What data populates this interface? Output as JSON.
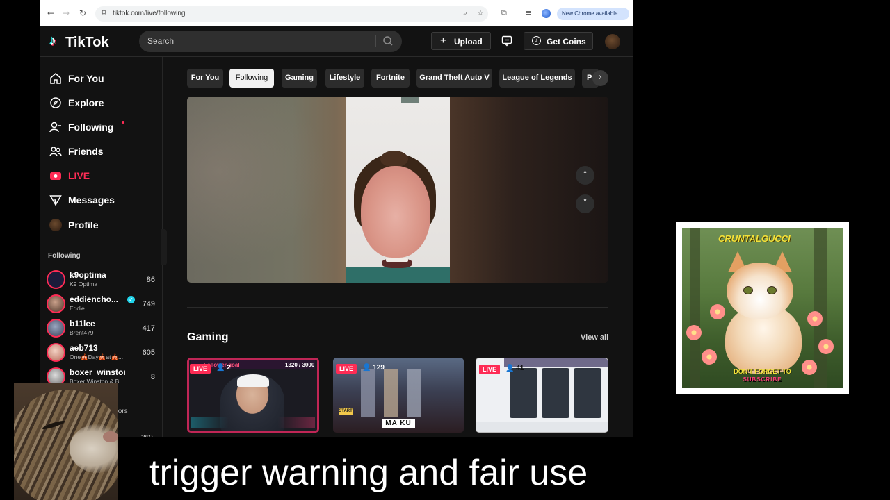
{
  "browser": {
    "url": "tiktok.com/live/following",
    "update_label": "New Chrome available"
  },
  "header": {
    "logo_text": "TikTok",
    "search_placeholder": "Search",
    "upload_label": "Upload",
    "coins_label": "Get Coins"
  },
  "sidebar": {
    "nav": [
      {
        "label": "For You",
        "icon": "home-icon"
      },
      {
        "label": "Explore",
        "icon": "compass-icon"
      },
      {
        "label": "Following",
        "icon": "person-follow-icon"
      },
      {
        "label": "Friends",
        "icon": "friends-icon"
      },
      {
        "label": "LIVE",
        "icon": "live-icon"
      },
      {
        "label": "Messages",
        "icon": "messages-icon"
      },
      {
        "label": "Profile",
        "icon": "profile-avatar"
      }
    ],
    "following_title": "Following",
    "accounts": [
      {
        "name": "k9optima",
        "sub": "K9 Optima",
        "count": "86"
      },
      {
        "name": "eddiencho...",
        "sub": "Eddie",
        "count": "749",
        "verified": true
      },
      {
        "name": "b11lee",
        "sub": "Brent479",
        "count": "417"
      },
      {
        "name": "aeb713",
        "sub": "One🎪Day🎪at🎪...",
        "count": "605"
      },
      {
        "name": "boxer_winston",
        "sub": "Boxer Winston & B...",
        "count": "8"
      }
    ],
    "more_text": "tors",
    "partial_count": "360"
  },
  "main": {
    "tabs": [
      "For You",
      "Following",
      "Gaming",
      "Lifestyle",
      "Fortnite",
      "Grand Theft Auto V",
      "League of Legends",
      "P"
    ],
    "active_tab": "Following",
    "section_title": "Gaming",
    "view_all": "View all",
    "cards": [
      {
        "badge": "LIVE",
        "viewers": "2",
        "overlay_goal": "Follower goal",
        "overlay_count": "1320 / 3000"
      },
      {
        "badge": "LIVE",
        "viewers": "129",
        "overlay_title": "MA KU",
        "overlay_start": "START"
      },
      {
        "badge": "LIVE",
        "viewers": "41"
      }
    ]
  },
  "overlay": {
    "brand": "CRUNTALGUCCI",
    "cta_line1": "DON'T FORGET TO",
    "cta_line2": "SUBSCRIBE",
    "caption": "trigger warning and fair use"
  },
  "colors": {
    "accent": "#fe2c55",
    "background": "#121212",
    "verified": "#20d5ec"
  }
}
